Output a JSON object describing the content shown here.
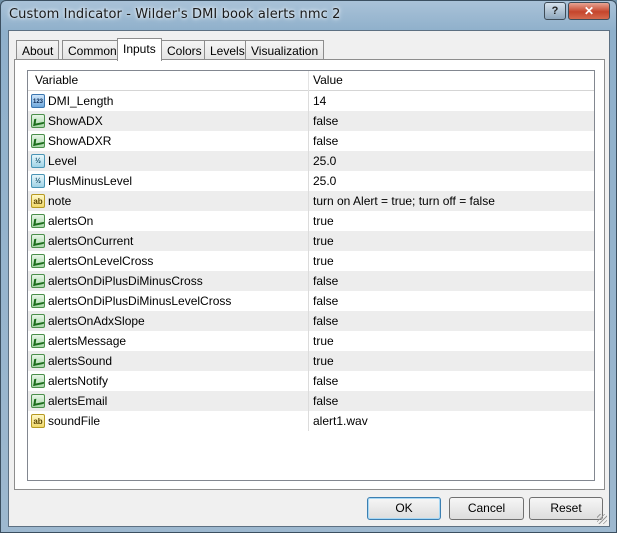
{
  "window": {
    "title": "Custom Indicator - Wilder's DMI book alerts nmc 2",
    "help_label": "?",
    "close_label": "✕"
  },
  "tabs": [
    "About",
    "Common",
    "Inputs",
    "Colors",
    "Levels",
    "Visualization"
  ],
  "active_tab": "Inputs",
  "grid": {
    "col_variable": "Variable",
    "col_value": "Value",
    "rows": [
      {
        "icon": "int-icon",
        "name": "DMI_Length",
        "value": "14"
      },
      {
        "icon": "bool-icon",
        "name": "ShowADX",
        "value": "false"
      },
      {
        "icon": "bool-icon",
        "name": "ShowADXR",
        "value": "false"
      },
      {
        "icon": "double-icon",
        "name": "Level",
        "value": "25.0"
      },
      {
        "icon": "double-icon",
        "name": "PlusMinusLevel",
        "value": "25.0"
      },
      {
        "icon": "string-icon",
        "name": "note",
        "value": "turn on Alert = true; turn off = false"
      },
      {
        "icon": "bool-icon",
        "name": "alertsOn",
        "value": "true"
      },
      {
        "icon": "bool-icon",
        "name": "alertsOnCurrent",
        "value": "true"
      },
      {
        "icon": "bool-icon",
        "name": "alertsOnLevelCross",
        "value": "true"
      },
      {
        "icon": "bool-icon",
        "name": "alertsOnDiPlusDiMinusCross",
        "value": "false"
      },
      {
        "icon": "bool-icon",
        "name": "alertsOnDiPlusDiMinusLevelCross",
        "value": "false"
      },
      {
        "icon": "bool-icon",
        "name": "alertsOnAdxSlope",
        "value": "false"
      },
      {
        "icon": "bool-icon",
        "name": "alertsMessage",
        "value": "true"
      },
      {
        "icon": "bool-icon",
        "name": "alertsSound",
        "value": "true"
      },
      {
        "icon": "bool-icon",
        "name": "alertsNotify",
        "value": "false"
      },
      {
        "icon": "bool-icon",
        "name": "alertsEmail",
        "value": "false"
      },
      {
        "icon": "string-icon",
        "name": "soundFile",
        "value": "alert1.wav"
      }
    ]
  },
  "buttons": {
    "ok": "OK",
    "cancel": "Cancel",
    "reset": "Reset"
  },
  "icon_glyphs": {
    "int-icon": "123",
    "double-icon": "½",
    "string-icon": "ab",
    "bool-icon": ""
  }
}
